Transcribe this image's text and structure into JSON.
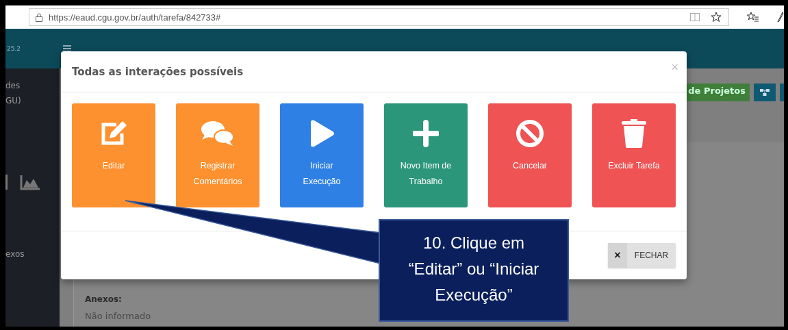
{
  "browser": {
    "url": "https://eaud.cgu.gov.br/auth/tarefa/842733#"
  },
  "header": {
    "version": "25.2"
  },
  "sidebar": {
    "items": [
      "des",
      "GU)",
      "exos"
    ]
  },
  "toolbar": {
    "button_label": "de Projetos"
  },
  "content": {
    "label": "Anexos:",
    "value": "Não informado"
  },
  "modal": {
    "title": "Todas as interações possíveis",
    "close": "×",
    "tiles": [
      {
        "label": "Editar",
        "color": "#fd902f",
        "kind": "edit"
      },
      {
        "label": "Registrar\nComentários",
        "color": "#fd902f",
        "kind": "comments"
      },
      {
        "label": "Iniciar\nExecução",
        "color": "#2f80e4",
        "kind": "play"
      },
      {
        "label": "Novo Item de\nTrabalho",
        "color": "#2b967a",
        "kind": "plus"
      },
      {
        "label": "Cancelar",
        "color": "#ef5353",
        "kind": "ban"
      },
      {
        "label": "Excluir Tarefa",
        "color": "#ef5353",
        "kind": "trash"
      }
    ],
    "close_button": {
      "icon": "×",
      "label": "FECHAR"
    }
  },
  "callout": {
    "text": "10. Clique em\n“Editar” ou “Iniciar\nExecução”"
  }
}
